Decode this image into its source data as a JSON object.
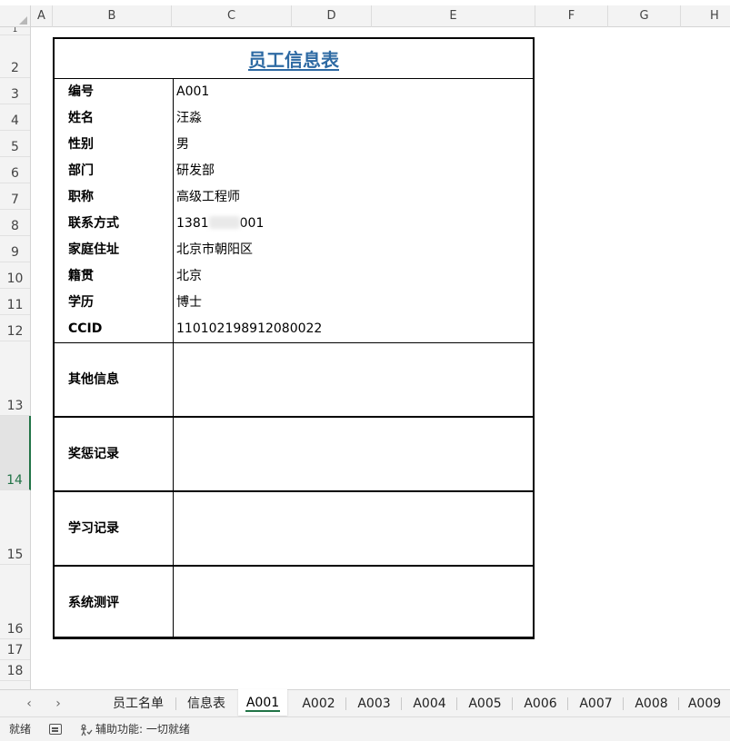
{
  "columns": [
    "A",
    "B",
    "C",
    "D",
    "E",
    "F",
    "G",
    "H"
  ],
  "rows": [
    "1",
    "2",
    "3",
    "4",
    "5",
    "6",
    "7",
    "8",
    "9",
    "10",
    "11",
    "12",
    "13",
    "14",
    "15",
    "16",
    "17",
    "18"
  ],
  "form": {
    "title": "员工信息表",
    "fields": [
      {
        "label": "编号",
        "value": "A001"
      },
      {
        "label": "姓名",
        "value": "汪淼"
      },
      {
        "label": "性别",
        "value": "男"
      },
      {
        "label": "部门",
        "value": "研发部"
      },
      {
        "label": "职称",
        "value": "高级工程师"
      },
      {
        "label": "联系方式",
        "value_prefix": "1381",
        "value_suffix": "001"
      },
      {
        "label": "家庭住址",
        "value": "北京市朝阳区"
      },
      {
        "label": "籍贯",
        "value": "北京"
      },
      {
        "label": "学历",
        "value": "博士"
      },
      {
        "label": "CCID",
        "value": "110102198912080022"
      }
    ],
    "blocks": [
      {
        "label": "其他信息"
      },
      {
        "label": "奖惩记录"
      },
      {
        "label": "学习记录"
      },
      {
        "label": "系统测评"
      }
    ]
  },
  "tabs": {
    "prev": "‹",
    "next": "›",
    "items": [
      "员工名单",
      "信息表",
      "A001",
      "A002",
      "A003",
      "A004",
      "A005",
      "A006",
      "A007",
      "A008",
      "A009"
    ],
    "active": "A001"
  },
  "status": {
    "ready": "就绪",
    "accessibility": "辅助功能: 一切就绪"
  },
  "colors": {
    "accent": "#217346",
    "title": "#2e6aa3"
  }
}
